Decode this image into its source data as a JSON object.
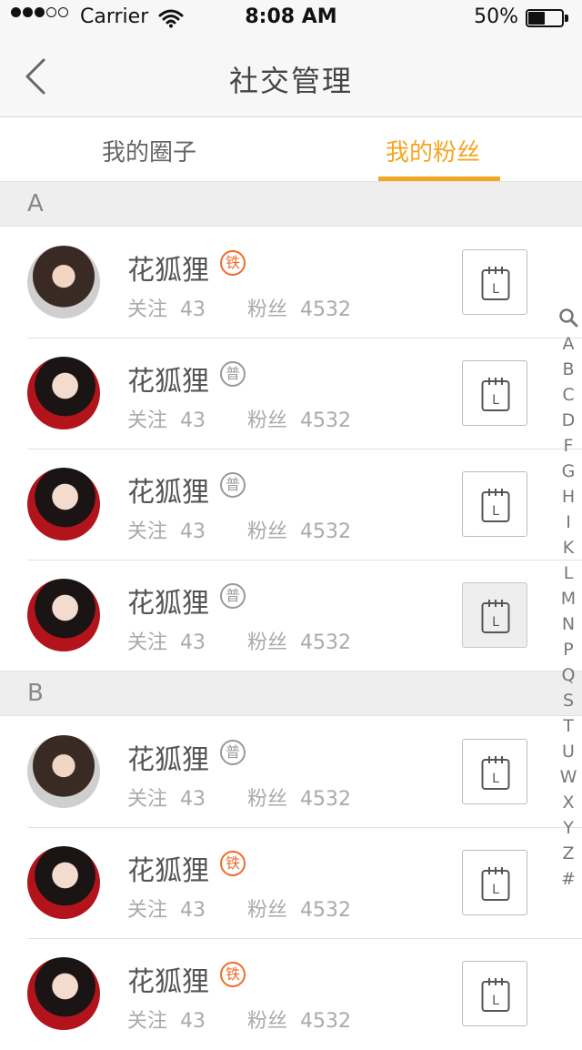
{
  "status_bar": {
    "carrier": "Carrier",
    "time": "8:08 AM",
    "battery": "50%",
    "signal_filled": 3,
    "signal_total": 5
  },
  "nav": {
    "title": "社交管理",
    "back_icon": "chevron-left-icon"
  },
  "tabs": [
    {
      "label": "我的圈子",
      "active": false
    },
    {
      "label": "我的粉丝",
      "active": true
    }
  ],
  "colors": {
    "accent": "#f5a623",
    "iron_badge": "#f06a2a",
    "common_badge": "#999999"
  },
  "sections": [
    {
      "letter": "A",
      "rows": [
        {
          "name": "花狐狸",
          "badge": "铁",
          "badge_type": "iron",
          "follow_label": "关注",
          "follow": "43",
          "fans_label": "粉丝",
          "fans": "4532"
        },
        {
          "name": "花狐狸",
          "badge": "普",
          "badge_type": "common",
          "follow_label": "关注",
          "follow": "43",
          "fans_label": "粉丝",
          "fans": "4532"
        },
        {
          "name": "花狐狸",
          "badge": "普",
          "badge_type": "common",
          "follow_label": "关注",
          "follow": "43",
          "fans_label": "粉丝",
          "fans": "4532"
        },
        {
          "name": "花狐狸",
          "badge": "普",
          "badge_type": "common",
          "follow_label": "关注",
          "follow": "43",
          "fans_label": "粉丝",
          "fans": "4532"
        }
      ]
    },
    {
      "letter": "B",
      "rows": [
        {
          "name": "花狐狸",
          "badge": "普",
          "badge_type": "common",
          "follow_label": "关注",
          "follow": "43",
          "fans_label": "粉丝",
          "fans": "4532"
        },
        {
          "name": "花狐狸",
          "badge": "铁",
          "badge_type": "iron",
          "follow_label": "关注",
          "follow": "43",
          "fans_label": "粉丝",
          "fans": "4532"
        },
        {
          "name": "花狐狸",
          "badge": "铁",
          "badge_type": "iron",
          "follow_label": "关注",
          "follow": "43",
          "fans_label": "粉丝",
          "fans": "4532"
        }
      ]
    }
  ],
  "calendar_button_icon": "calendar-icon",
  "calendar_button_glyph": "L",
  "index_bar": {
    "search_icon": "search-icon",
    "letters": [
      "A",
      "B",
      "C",
      "D",
      "F",
      "G",
      "H",
      "I",
      "K",
      "L",
      "M",
      "N",
      "P",
      "Q",
      "S",
      "T",
      "U",
      "W",
      "X",
      "Y",
      "Z",
      "#"
    ]
  }
}
